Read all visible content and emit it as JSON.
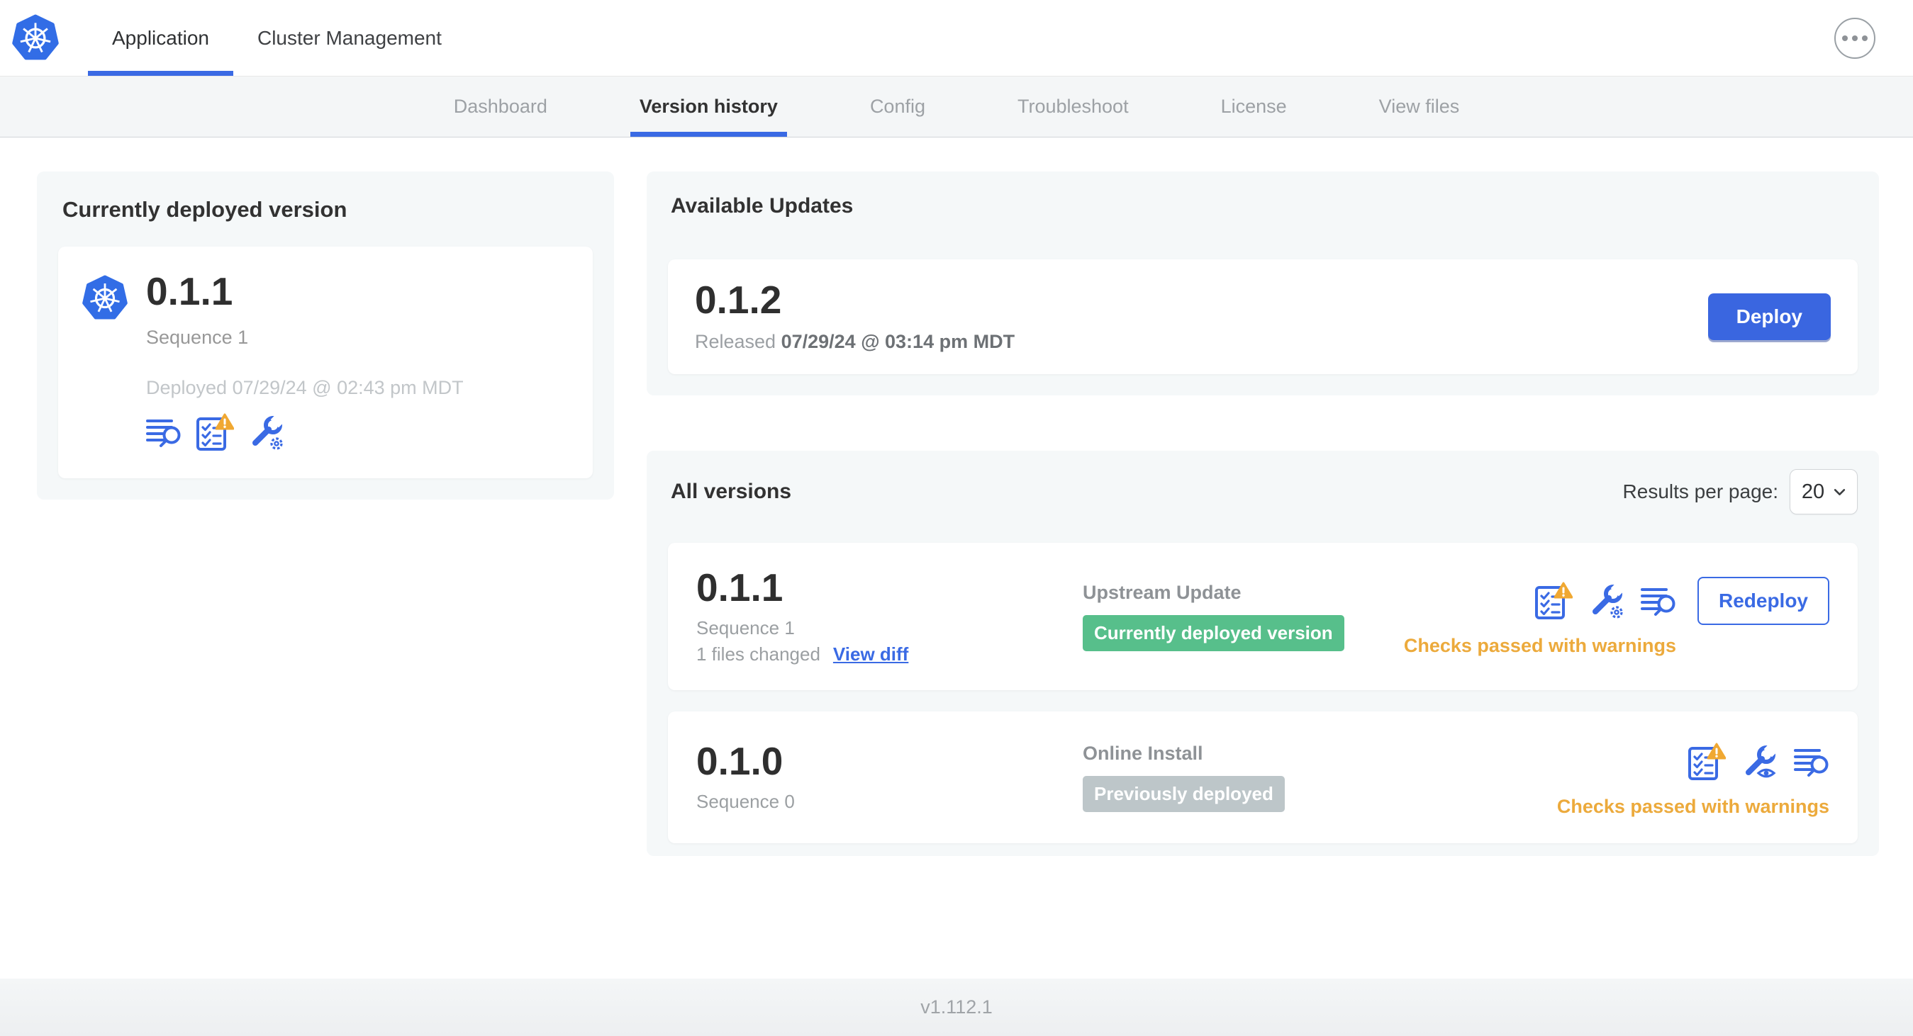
{
  "header": {
    "app_tabs": [
      {
        "label": "Application",
        "active": true
      },
      {
        "label": "Cluster Management",
        "active": false
      }
    ]
  },
  "subnav": {
    "items": [
      {
        "label": "Dashboard",
        "active": false
      },
      {
        "label": "Version history",
        "active": true
      },
      {
        "label": "Config",
        "active": false
      },
      {
        "label": "Troubleshoot",
        "active": false
      },
      {
        "label": "License",
        "active": false
      },
      {
        "label": "View files",
        "active": false
      }
    ]
  },
  "deployed_card": {
    "title": "Currently deployed version",
    "version": "0.1.1",
    "sequence": "Sequence 1",
    "deployed_at": "Deployed 07/29/24 @ 02:43 pm MDT",
    "icons": [
      "diff-logs-icon",
      "preflight-checks-warning-icon",
      "edit-config-icon"
    ]
  },
  "available_updates": {
    "title": "Available Updates",
    "version": "0.1.2",
    "released_label": "Released",
    "released_at": "07/29/24 @ 03:14 pm MDT",
    "deploy_label": "Deploy"
  },
  "all_versions": {
    "title": "All versions",
    "results_per_page_label": "Results per page:",
    "results_per_page_value": "20",
    "rows": [
      {
        "version": "0.1.1",
        "sequence": "Sequence 1",
        "files_changed": "1 files changed",
        "view_diff_label": "View diff",
        "source": "Upstream Update",
        "badge_label": "Currently deployed version",
        "badge_type": "success",
        "status": "Checks passed with warnings",
        "action_label": "Redeploy",
        "icons": [
          "preflight-checks-warning-icon",
          "edit-config-icon",
          "diff-logs-icon"
        ]
      },
      {
        "version": "0.1.0",
        "sequence": "Sequence 0",
        "source": "Online Install",
        "badge_label": "Previously deployed",
        "badge_type": "muted",
        "status": "Checks passed with warnings",
        "icons": [
          "preflight-checks-warning-icon",
          "view-config-icon",
          "diff-logs-icon"
        ]
      }
    ]
  },
  "footer": {
    "version_label": "v1.112.1"
  },
  "colors": {
    "accent_blue": "#3a6ae4",
    "kubernetes_blue": "#326de6",
    "success_green": "#57bf8b",
    "muted_badge_gray": "#bdc6c9",
    "warning_orange": "#ecaa3c"
  }
}
